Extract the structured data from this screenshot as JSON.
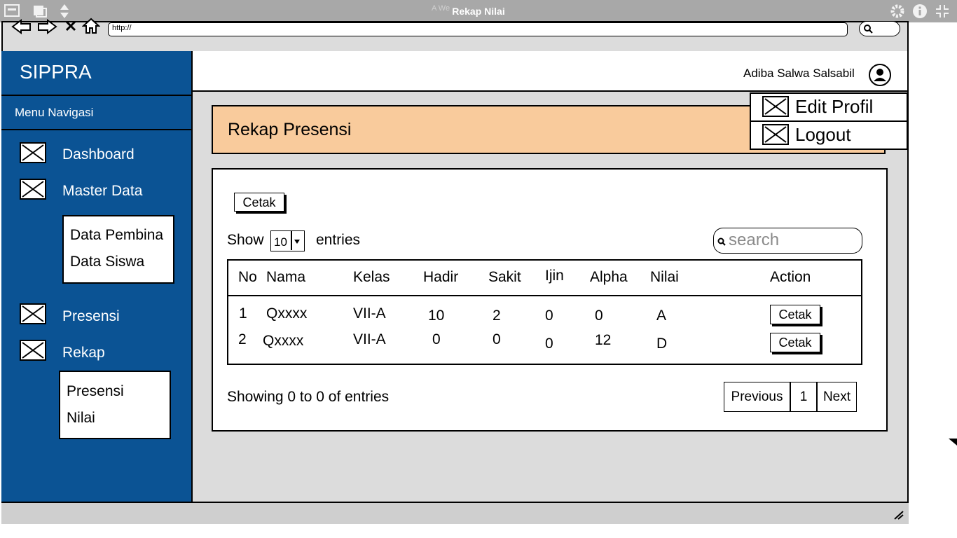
{
  "window": {
    "title": "Rekap Nilai",
    "ghost_title": "A We"
  },
  "browser": {
    "url": "http://"
  },
  "sidebar": {
    "brand": "SIPPRA",
    "menu_heading": "Menu Navigasi",
    "items": [
      {
        "label": "Dashboard"
      },
      {
        "label": "Master Data",
        "submenu": [
          "Data Pembina",
          "Data Siswa"
        ]
      },
      {
        "label": "Presensi"
      },
      {
        "label": "Rekap",
        "submenu": [
          "Presensi",
          "Nilai"
        ]
      }
    ]
  },
  "header": {
    "username": "Adiba Salwa Salsabil",
    "user_menu": [
      "Edit Profil",
      "Logout"
    ]
  },
  "page": {
    "title": "Rekap Presensi",
    "print_button": "Cetak",
    "show_label": "Show",
    "entries_value": "10",
    "entries_label": "entries",
    "search_placeholder": "search",
    "table": {
      "headers": [
        "No",
        "Nama",
        "Kelas",
        "Hadir",
        "Sakit",
        "Ijin",
        "Alpha",
        "Nilai",
        "Action"
      ],
      "rows": [
        {
          "no": "1",
          "nama": "Qxxxx",
          "kelas": "VII-A",
          "hadir": "10",
          "sakit": "2",
          "ijin": "0",
          "alpha": "0",
          "nilai": "A",
          "action": "Cetak"
        },
        {
          "no": "2",
          "nama": "Qxxxx",
          "kelas": "VII-A",
          "hadir": "0",
          "sakit": "0",
          "ijin": "0",
          "alpha": "12",
          "nilai": "D",
          "action": "Cetak"
        }
      ]
    },
    "footer_info": "Showing 0 to 0 of entries",
    "pagination": {
      "previous": "Previous",
      "page": "1",
      "next": "Next"
    }
  }
}
